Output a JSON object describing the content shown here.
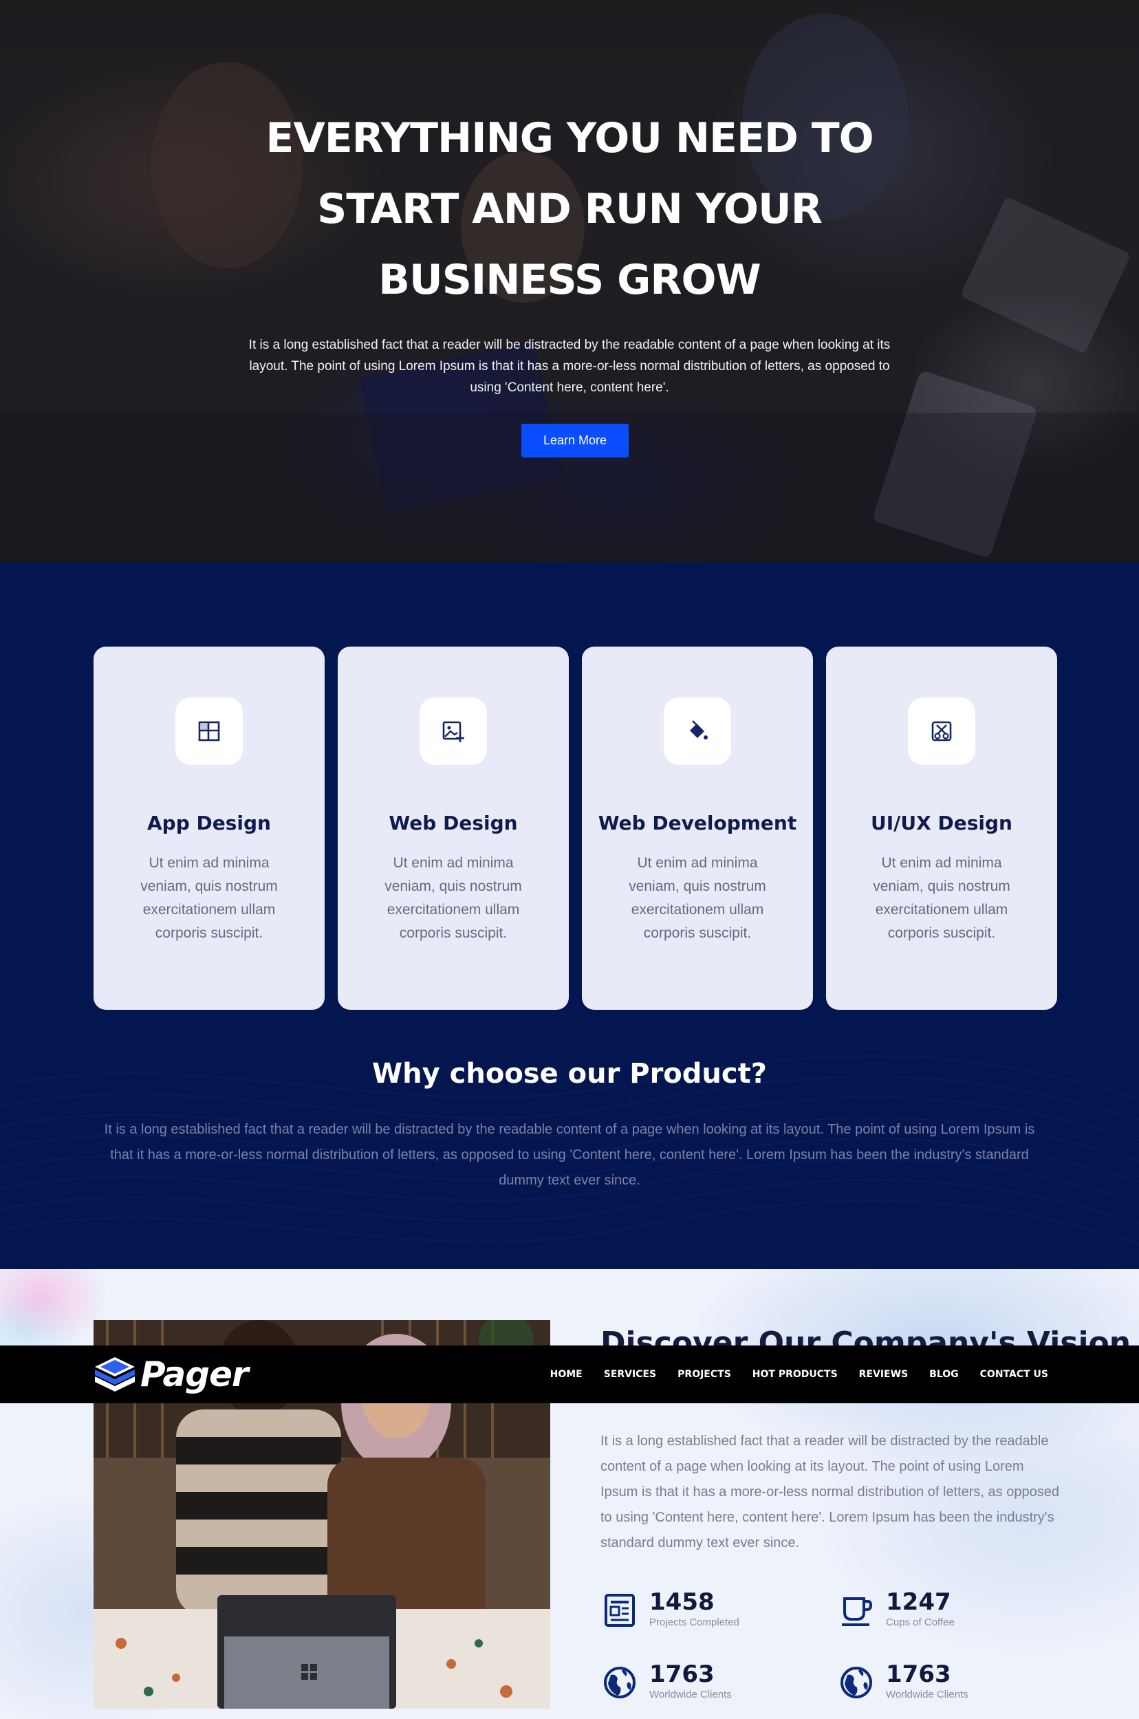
{
  "hero": {
    "title_line1": "EVERYTHING YOU NEED TO",
    "title_line2": "START AND RUN YOUR",
    "title_line3": "BUSINESS GROW",
    "text": "It is a long established fact that a reader will be distracted by the readable content of a page when looking at its layout. The point of using Lorem Ipsum is that it has a more-or-less normal distribution of letters, as opposed to using 'Content here, content here'.",
    "button_label": "Learn More"
  },
  "services": {
    "cards": [
      {
        "title": "App Design",
        "icon": "layout-icon",
        "text": "Ut enim ad minima veniam, quis nostrum exercitationem ullam corporis suscipit."
      },
      {
        "title": "Web Design",
        "icon": "image-add-icon",
        "text": "Ut enim ad minima veniam, quis nostrum exercitationem ullam corporis suscipit."
      },
      {
        "title": "Web Development",
        "icon": "paint-bucket-icon",
        "text": "Ut enim ad minima veniam, quis nostrum exercitationem ullam corporis suscipit."
      },
      {
        "title": "UI/UX Design",
        "icon": "design-tools-icon",
        "text": "Ut enim ad minima veniam, quis nostrum exercitationem ullam corporis suscipit."
      }
    ],
    "why_title": "Why choose our Product?",
    "why_text": "It is a long established fact that a reader will be distracted by the readable content of a page when looking at its layout. The point of using Lorem Ipsum is that it has a more-or-less normal distribution of letters, as opposed to using 'Content here, content here'. Lorem Ipsum has been the industry's standard dummy text ever since."
  },
  "vision": {
    "title": "Discover Our Company's Vision",
    "text": "It is a long established fact that a reader will be distracted by the readable content of a page when looking at its layout. The point of using Lorem Ipsum is that it has a more-or-less normal distribution of letters, as opposed to using 'Content here, content here'. Lorem Ipsum has been the industry's standard dummy text ever since.",
    "stats": [
      {
        "value": "1458",
        "label": "Projects Completed",
        "icon": "newspaper-icon"
      },
      {
        "value": "1247",
        "label": "Cups of Coffee",
        "icon": "coffee-cup-icon"
      },
      {
        "value": "1763",
        "label": "Worldwide Clients",
        "icon": "globe-icon"
      },
      {
        "value": "1763",
        "label": "Worldwide Clients",
        "icon": "globe-icon"
      }
    ]
  },
  "navbar": {
    "logo_text": "Pager",
    "items": [
      "HOME",
      "SERVICES",
      "PROJECTS",
      "HOT PRODUCTS",
      "REVIEWS",
      "BLOG",
      "CONTACT US"
    ]
  },
  "colors": {
    "accent": "#0b4eff",
    "navy": "#031650",
    "card_bg": "#e8ebf7",
    "navbar_bg": "#000000"
  }
}
